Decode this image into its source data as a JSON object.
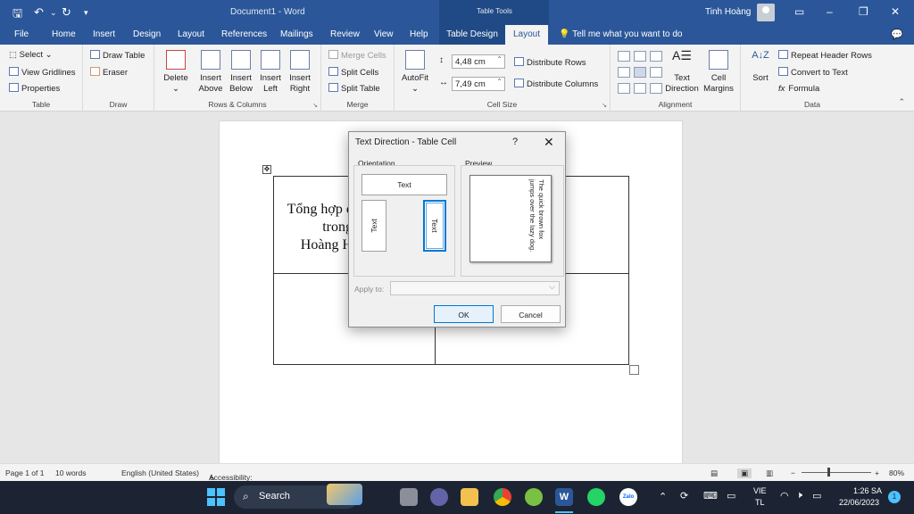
{
  "titlebar": {
    "save_icon": "save-icon",
    "title": "Document1  -  Word",
    "table_tools": "Table Tools",
    "user": "Tinh Hoàng",
    "minimize": "–",
    "restore": "❐",
    "close": "✕"
  },
  "tabs": [
    "File",
    "Home",
    "Insert",
    "Design",
    "Layout",
    "References",
    "Mailings",
    "Review",
    "View",
    "Help"
  ],
  "context_tabs": {
    "table_design": "Table Design",
    "layout": "Layout"
  },
  "tellme": "Tell me what you want to do",
  "ribbon": {
    "table": {
      "select": "Select",
      "gridlines": "View Gridlines",
      "properties": "Properties",
      "label": "Table"
    },
    "draw": {
      "draw_table": "Draw Table",
      "eraser": "Eraser",
      "label": "Draw"
    },
    "rows_cols": {
      "delete": "Delete",
      "insert_above": [
        "Insert",
        "Above"
      ],
      "insert_below": [
        "Insert",
        "Below"
      ],
      "insert_left": [
        "Insert",
        "Left"
      ],
      "insert_right": [
        "Insert",
        "Right"
      ],
      "label": "Rows & Columns"
    },
    "merge": {
      "merge_cells": "Merge Cells",
      "split_cells": "Split Cells",
      "split_table": "Split Table",
      "label": "Merge"
    },
    "cell_size": {
      "autofit": "AutoFit",
      "height": "4,48 cm",
      "width": "7,49 cm",
      "dist_rows": "Distribute Rows",
      "dist_cols": "Distribute Columns",
      "label": "Cell Size"
    },
    "alignment": {
      "text_direction": [
        "Text",
        "Direction"
      ],
      "cell_margins": [
        "Cell",
        "Margins"
      ],
      "label": "Alignment"
    },
    "data": {
      "sort": "Sort",
      "repeat_header": "Repeat Header Rows",
      "convert": "Convert to Text",
      "formula": "Formula",
      "label": "Data"
    }
  },
  "document": {
    "cell_text": "Tổng hợp c\ntrong\nHoàng H"
  },
  "dialog": {
    "title": "Text Direction - Table Cell",
    "help": "?",
    "close": "✕",
    "orientation_label": "Orientation",
    "preview_label": "Preview",
    "option_text": "Text",
    "preview_text": "The quick brown fox jumps over the lazy dog.",
    "apply_to_label": "Apply to:",
    "ok": "OK",
    "cancel": "Cancel"
  },
  "status": {
    "page": "Page 1 of 1",
    "words": "10 words",
    "language": "English (United States)",
    "accessibility": "Accessibility: Good to go",
    "zoom": "80%"
  },
  "taskbar": {
    "search": "Search",
    "lang1": "VIE",
    "lang2": "TL",
    "time": "1:26 SA",
    "date": "22/06/2023",
    "notif": "1"
  }
}
